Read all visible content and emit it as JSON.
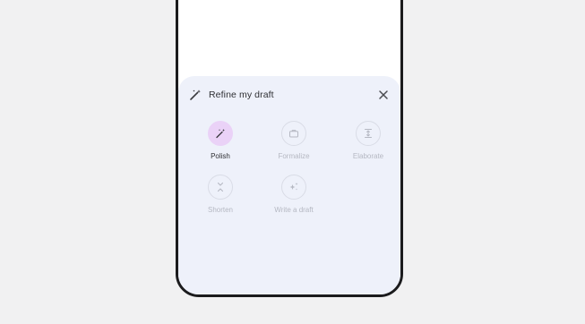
{
  "sheet": {
    "title": "Refine my draft",
    "title_icon": "magic-wand-icon",
    "close_icon": "close-icon"
  },
  "options": [
    {
      "label": "Polish",
      "icon": "magic-wand-icon",
      "selected": true
    },
    {
      "label": "Formalize",
      "icon": "briefcase-icon",
      "selected": false
    },
    {
      "label": "Elaborate",
      "icon": "expand-vertical-icon",
      "selected": false
    },
    {
      "label": "Shorten",
      "icon": "collapse-vertical-icon",
      "selected": false
    },
    {
      "label": "Write a draft",
      "icon": "sparkle-icon",
      "selected": false
    }
  ],
  "colors": {
    "background": "#f1f1f2",
    "sheet": "#eef1fa",
    "selected_chip": "#ead2f7",
    "text": "#2f3034",
    "muted_text": "#b5b8c2"
  }
}
